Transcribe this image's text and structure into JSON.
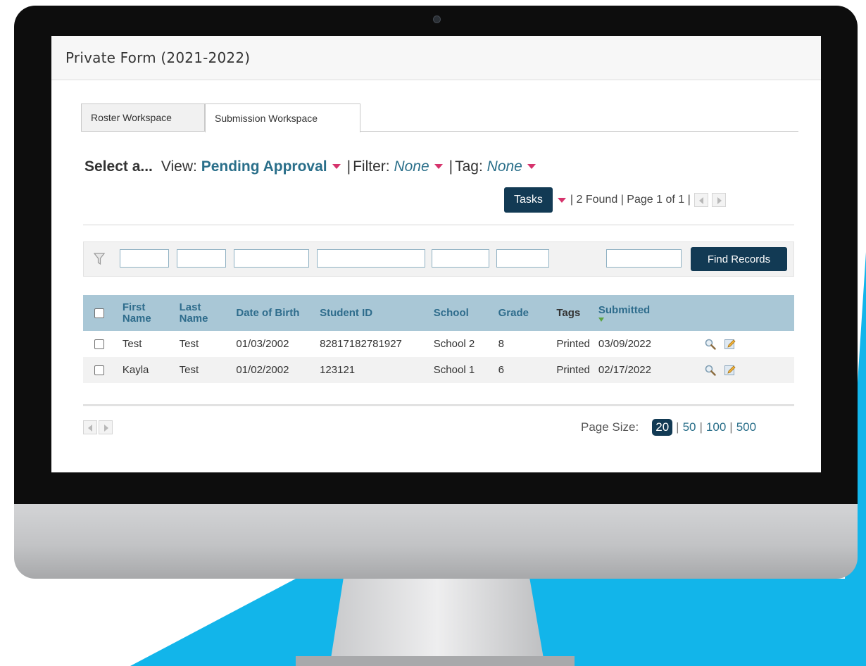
{
  "app": {
    "title": "Private Form (2021-2022)"
  },
  "tabs": [
    {
      "label": "Roster Workspace",
      "active": false
    },
    {
      "label": "Submission Workspace",
      "active": true
    }
  ],
  "selector": {
    "prompt": "Select a...",
    "view_label": "View:",
    "view_value": "Pending Approval",
    "filter_label": "Filter:",
    "filter_value": "None",
    "tag_label": "Tag:",
    "tag_value": "None"
  },
  "taskbar": {
    "tasks_label": "Tasks",
    "found_text": "2 Found",
    "page_text": "Page 1 of 1"
  },
  "filter_row": {
    "button_label": "Find Records"
  },
  "table": {
    "columns": [
      "First Name",
      "Last Name",
      "Date of Birth",
      "Student ID",
      "School",
      "Grade",
      "Tags",
      "Submitted"
    ],
    "rows": [
      {
        "first": "Test",
        "last": "Test",
        "dob": "01/03/2002",
        "student_id": "82817182781927",
        "school": "School 2",
        "grade": "8",
        "tags": "Printed",
        "submitted": "03/09/2022"
      },
      {
        "first": "Kayla",
        "last": "Test",
        "dob": "01/02/2002",
        "student_id": "123121",
        "school": "School 1",
        "grade": "6",
        "tags": "Printed",
        "submitted": "02/17/2022"
      }
    ]
  },
  "page_size": {
    "label": "Page Size:",
    "active": "20",
    "options": [
      "50",
      "100",
      "500"
    ]
  },
  "colors": {
    "accent_dark": "#123a54",
    "link": "#2a6f8a",
    "header_bg": "#a9c7d6",
    "background_accent": "#12b5ea",
    "caret": "#d6336c"
  },
  "icons": [
    "filter-funnel-icon",
    "magnifier-icon",
    "edit-pencil-icon",
    "prev-page-icon",
    "next-page-icon",
    "sort-down-arrow-icon"
  ]
}
